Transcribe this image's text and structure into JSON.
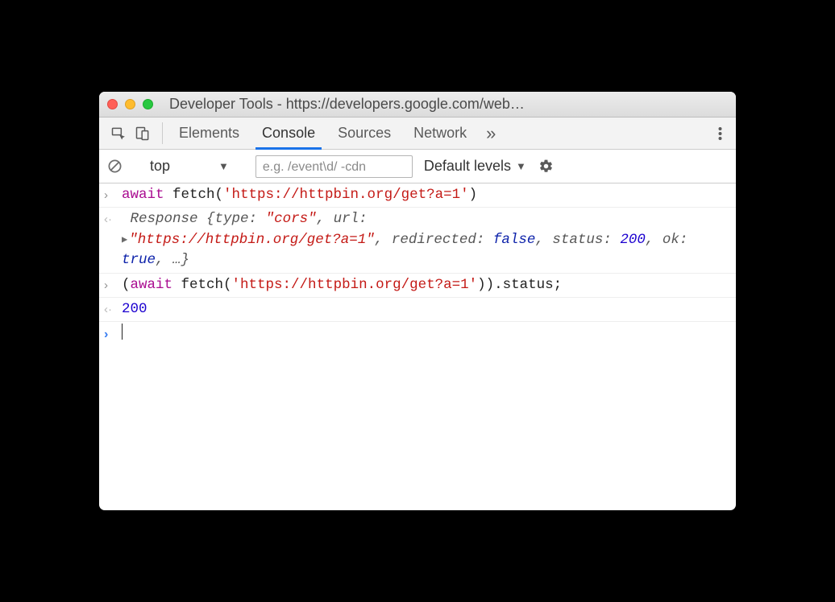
{
  "window": {
    "title": "Developer Tools - https://developers.google.com/web…"
  },
  "tabs": {
    "elements": "Elements",
    "console": "Console",
    "sources": "Sources",
    "network": "Network",
    "more": "»"
  },
  "toolbar": {
    "context": "top",
    "filter_placeholder": "e.g. /event\\d/ -cdn",
    "levels": "Default levels"
  },
  "console": {
    "entry1": {
      "await": "await",
      "fn": " fetch(",
      "url": "'https://httpbin.org/get?a=1'",
      "close": ")"
    },
    "response1": {
      "lead": "Response ",
      "open": "{",
      "k_type": "type: ",
      "v_type": "\"cors\"",
      "c1": ", ",
      "k_url": "url: ",
      "v_url": "\"https://httpbin.org/get?a=1\"",
      "c2": ", ",
      "k_redir": "redirected: ",
      "v_redir": "false",
      "c3": ", ",
      "k_status": "status: ",
      "v_status": "200",
      "c4": ", ",
      "k_ok": "ok: ",
      "v_ok": "true",
      "c5": ", …",
      "close": "}"
    },
    "entry2": {
      "open": "(",
      "await": "await",
      "fn": " fetch(",
      "url": "'https://httpbin.org/get?a=1'",
      "close_inner": ")",
      "close_outer": ")",
      "tail": ".status;"
    },
    "result2": "200"
  }
}
